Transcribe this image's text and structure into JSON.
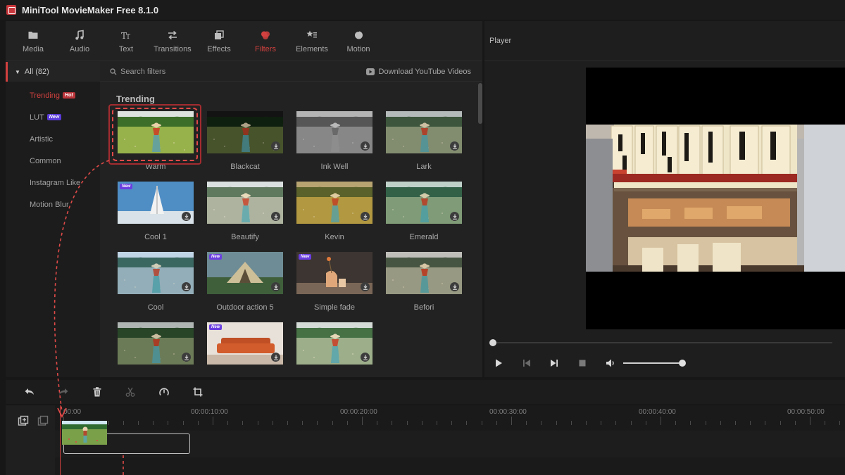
{
  "app": {
    "title": "MiniTool MovieMaker Free 8.1.0"
  },
  "toolbar": {
    "tabs": [
      {
        "label": "Media",
        "icon": "folder-icon"
      },
      {
        "label": "Audio",
        "icon": "music-note-icon"
      },
      {
        "label": "Text",
        "icon": "text-icon"
      },
      {
        "label": "Transitions",
        "icon": "transition-arrows-icon"
      },
      {
        "label": "Effects",
        "icon": "effects-icon"
      },
      {
        "label": "Filters",
        "icon": "filters-icon",
        "active": true
      },
      {
        "label": "Elements",
        "icon": "elements-icon"
      },
      {
        "label": "Motion",
        "icon": "motion-icon"
      }
    ]
  },
  "categories": {
    "all_label": "All (82)",
    "items": [
      {
        "label": "Trending",
        "badge": "Hot",
        "active": true
      },
      {
        "label": "LUT",
        "badge": "New"
      },
      {
        "label": "Artistic"
      },
      {
        "label": "Common"
      },
      {
        "label": "Instagram Like"
      },
      {
        "label": "Motion Blur"
      }
    ]
  },
  "search": {
    "placeholder": "Search filters",
    "download_label": "Download YouTube Videos"
  },
  "section": {
    "title": "Trending"
  },
  "filters": [
    {
      "label": "Warm",
      "style": "warm",
      "selected": true
    },
    {
      "label": "Blackcat",
      "style": "blackcat",
      "download": true
    },
    {
      "label": "Ink Well",
      "style": "inkwell",
      "download": true
    },
    {
      "label": "Lark",
      "style": "lark",
      "download": true
    },
    {
      "label": "Cool 1",
      "style": "sail",
      "new": true,
      "download": true
    },
    {
      "label": "Beautify",
      "style": "beautify",
      "download": true
    },
    {
      "label": "Kevin",
      "style": "kevin",
      "download": true
    },
    {
      "label": "Emerald",
      "style": "emerald",
      "download": true
    },
    {
      "label": "Cool",
      "style": "cool",
      "download": true
    },
    {
      "label": "Outdoor action 5",
      "style": "tent",
      "new": true,
      "download": true
    },
    {
      "label": "Simple fade",
      "style": "vase",
      "new": true,
      "download": true
    },
    {
      "label": "Befori",
      "style": "befori",
      "download": true
    },
    {
      "label": "",
      "style": "plain",
      "download": true
    },
    {
      "label": "",
      "style": "sofa",
      "new": true,
      "download": true
    },
    {
      "label": "",
      "style": "plain2",
      "download": true
    }
  ],
  "badges": {
    "new_label": "New"
  },
  "player": {
    "title": "Player",
    "progress": 0.0,
    "volume": 0.95
  },
  "timeline": {
    "ruler": [
      "00:00",
      "00:00:10:00",
      "00:00:20:00",
      "00:00:30:00",
      "00:00:40:00",
      "00:00:50:00"
    ]
  },
  "colors": {
    "accent": "#d2413f",
    "panel": "#222222",
    "background": "#171717"
  }
}
